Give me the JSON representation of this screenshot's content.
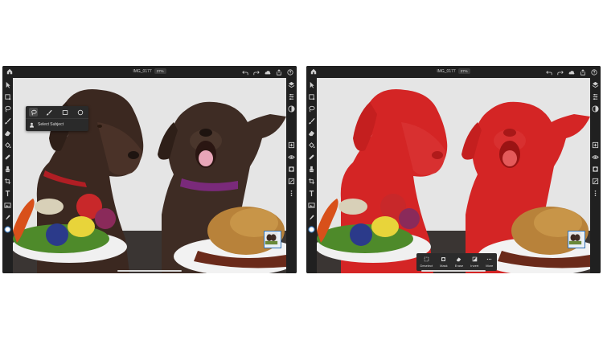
{
  "document": {
    "title": "IMG_0177",
    "zoom": "37%"
  },
  "colors": {
    "chrome": "#1c1c1c",
    "toolbar": "#202020",
    "mask": "#d42525",
    "accent": "#2f6fb3"
  },
  "top_icons": [
    "undo-icon",
    "redo-icon",
    "cloud-icon",
    "share-icon",
    "help-icon"
  ],
  "left_tools": [
    "select-arrow-icon",
    "crop-transform-icon",
    "lasso-icon",
    "brush-icon",
    "eraser-icon",
    "fill-icon",
    "healing-icon",
    "clone-icon",
    "crop-icon",
    "type-icon",
    "image-icon",
    "eyedropper-icon",
    "color-swatch-icon"
  ],
  "right_tools": [
    "layers-icon",
    "layer-properties-icon",
    "adjustments-icon",
    "add-layer-icon",
    "visibility-icon",
    "mask-icon",
    "fx-icon",
    "more-icon"
  ],
  "selection_popup": {
    "select_subject_label": "Select Subject"
  },
  "action_bar": {
    "items": [
      {
        "label": "Deselect",
        "icon": "deselect-icon"
      },
      {
        "label": "Mask",
        "icon": "mask-icon"
      },
      {
        "label": "Erase",
        "icon": "erase-icon"
      },
      {
        "label": "Invert",
        "icon": "invert-icon"
      },
      {
        "label": "More",
        "icon": "more-icon"
      }
    ]
  }
}
